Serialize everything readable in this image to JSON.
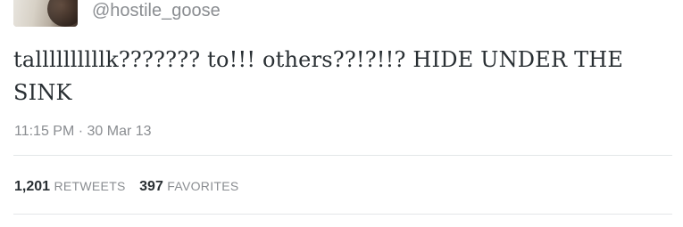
{
  "tweet": {
    "handle": "@hostile_goose",
    "text": "tallllllllllk??????? to!!! others??!?!!? HIDE UNDER THE SINK",
    "time": "11:15 PM",
    "separator": "·",
    "date": "30 Mar 13"
  },
  "stats": {
    "retweets_count": "1,201",
    "retweets_label": "RETWEETS",
    "favorites_count": "397",
    "favorites_label": "FAVORITES"
  }
}
